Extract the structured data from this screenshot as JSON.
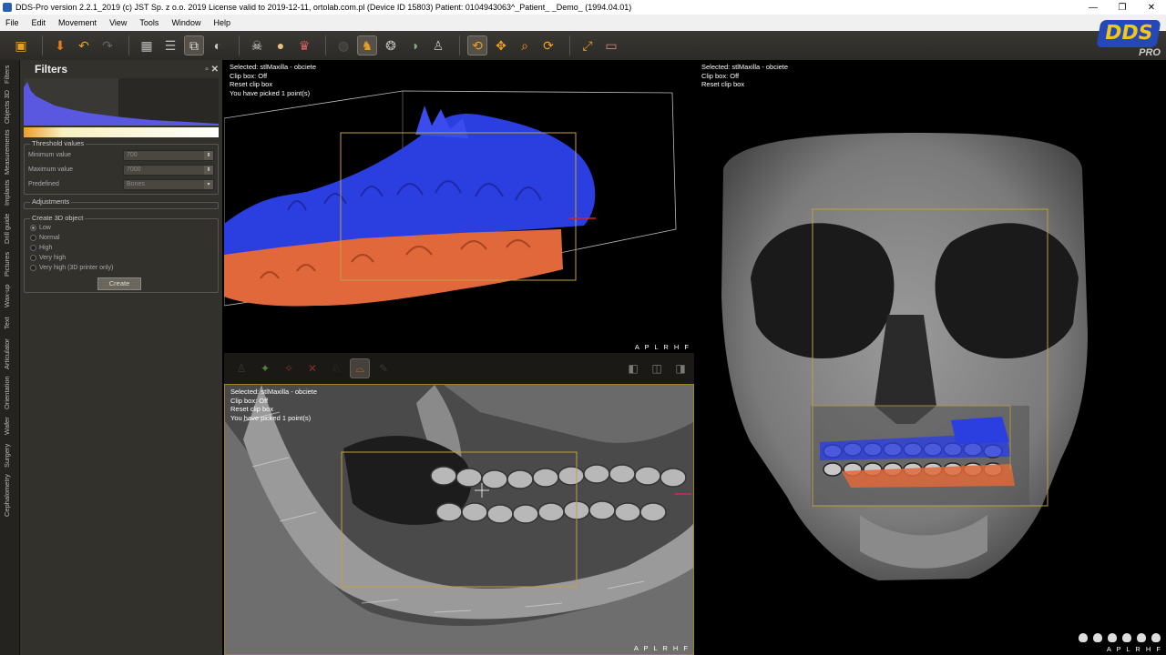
{
  "window": {
    "title": "DDS-Pro version 2.2.1_2019 (c) JST Sp. z o.o. 2019 License valid to 2019-12-11, ortolab.com.pl (Device ID 15803) Patient: 0104943063^_Patient_ _Demo_ (1994.04.01)",
    "minimize": "—",
    "maximize": "❐",
    "close": "✕"
  },
  "menu": [
    "File",
    "Edit",
    "Movement",
    "View",
    "Tools",
    "Window",
    "Help"
  ],
  "logo": {
    "text": "DDS",
    "sub": "PRO",
    "colors": {
      "blue": "#2448b8",
      "yellow": "#f5c518"
    }
  },
  "vertical_tabs": [
    "Filters",
    "Objects 3D",
    "Measurements",
    "Implants",
    "Drill guide",
    "Pictures",
    "Wax-up",
    "Text",
    "Articulator",
    "Orientation",
    "Wafer",
    "Surgery",
    "Cephalometry"
  ],
  "panel": {
    "title": "Filters",
    "threshold_group": "Threshold values",
    "min_label": "Minimum value",
    "min_value": "700",
    "max_label": "Maximum value",
    "max_value": "7000",
    "predefined_label": "Predefined",
    "predefined_value": "Bones",
    "adjustments_group": "Adjustments",
    "create_group": "Create 3D object",
    "options": [
      {
        "label": "Low",
        "selected": true
      },
      {
        "label": "Normal",
        "selected": false
      },
      {
        "label": "High",
        "selected": false
      },
      {
        "label": "Very high",
        "selected": false
      },
      {
        "label": "Very high (3D printer only)",
        "selected": false
      }
    ],
    "create_button": "Create"
  },
  "viewports": {
    "top_left": {
      "selected": "Selected: stlMaxilla - obciete",
      "clip": "Clip box: Off",
      "reset": "Reset clip box",
      "picked": "You have picked 1 point(s)",
      "orient": "A P L R H F"
    },
    "bottom_left": {
      "selected": "Selected: stlMaxilla - obciete",
      "clip": "Clip box: Off",
      "reset": "Reset clip box",
      "picked": "You have picked 1 point(s)",
      "orient": "A P L R H F"
    },
    "right": {
      "selected": "Selected: stlMaxilla - obciete",
      "clip": "Clip box: Off",
      "reset": "Reset clip box",
      "orient": "A P L R H F"
    }
  },
  "colors": {
    "maxilla": "#2b3ee0",
    "mandible": "#e0683a",
    "bone": "#8a8a8a",
    "clipbox": "#c0a040"
  }
}
